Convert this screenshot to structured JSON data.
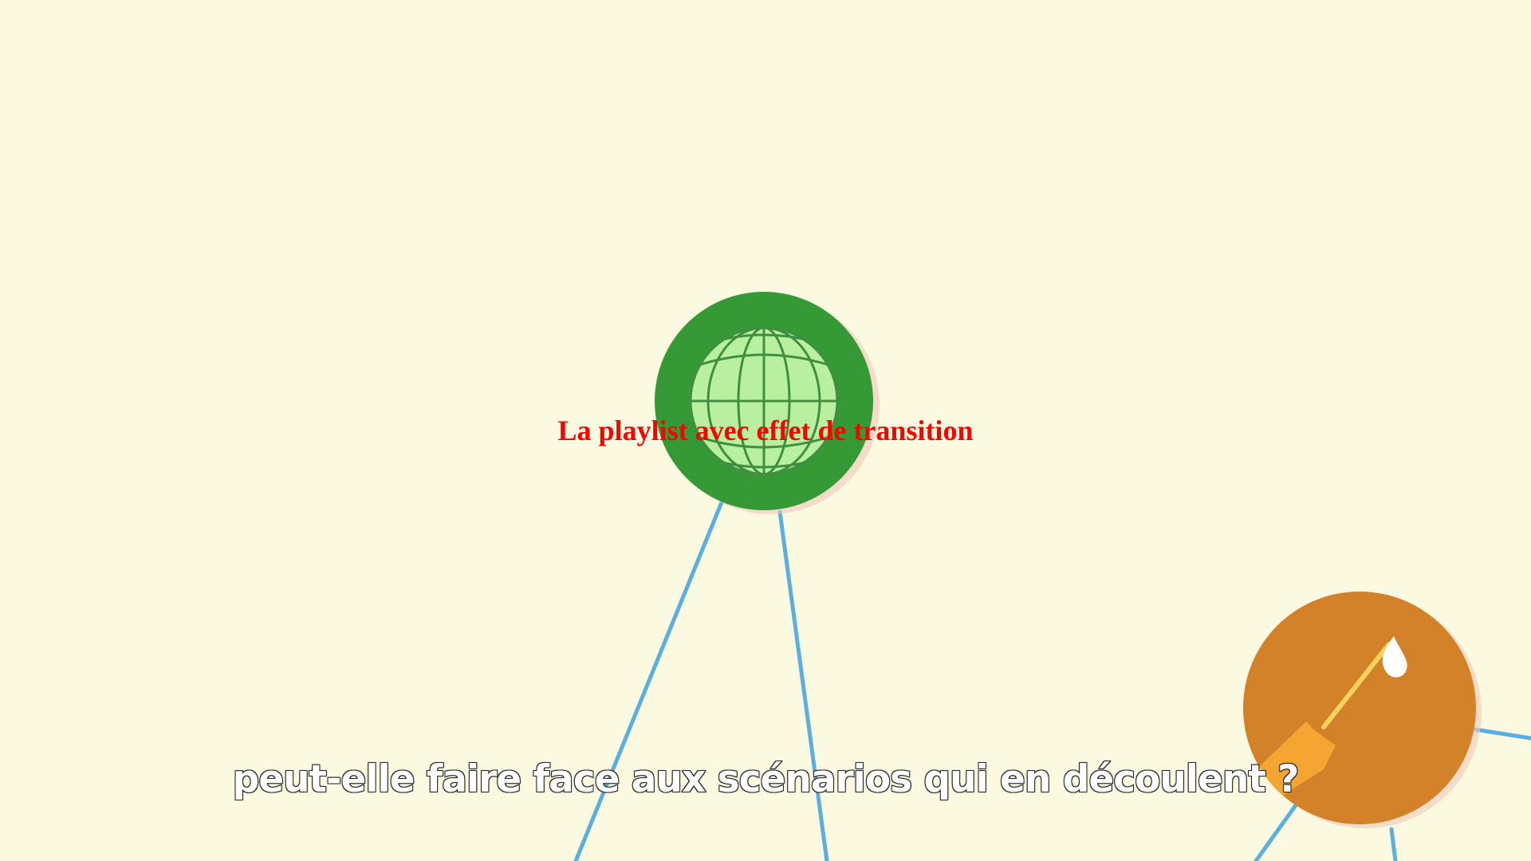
{
  "video": {
    "overlay_title": "La playlist avec effet de transition",
    "subtitle": "peut-elle faire face aux scénarios qui en découlent ?"
  },
  "icons": {
    "center_node": "globe-icon",
    "corner_node": "syringe-icon"
  },
  "colors": {
    "background": "#fbf9e0",
    "globe_ring": "#359a35",
    "globe_fill": "#b8f0a0",
    "orange_node": "#d4822a",
    "connector_lines": "#5aaee0",
    "title": "#ff0000"
  }
}
